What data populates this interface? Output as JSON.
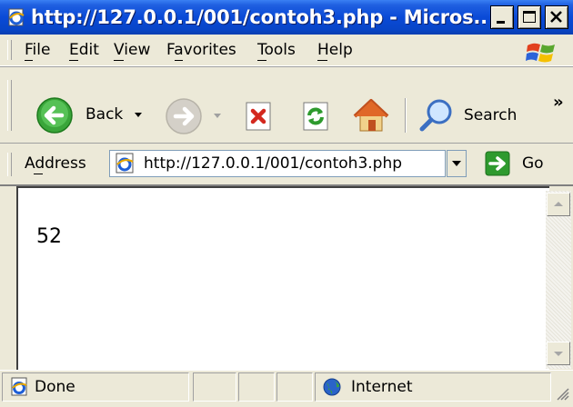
{
  "window": {
    "title": "http://127.0.0.1/001/contoh3.php - Micros...",
    "accent": "#0a4ad7"
  },
  "menu": {
    "items": [
      {
        "label": "File",
        "key": "F"
      },
      {
        "label": "Edit",
        "key": "E"
      },
      {
        "label": "View",
        "key": "V"
      },
      {
        "label": "Favorites",
        "key": "a"
      },
      {
        "label": "Tools",
        "key": "T"
      },
      {
        "label": "Help",
        "key": "H"
      }
    ]
  },
  "toolbar": {
    "back_label": "Back",
    "search_label": "Search",
    "chevron": "»",
    "icons": [
      "back-arrow-icon",
      "forward-arrow-icon",
      "stop-icon",
      "refresh-icon",
      "home-icon",
      "search-icon"
    ]
  },
  "address": {
    "label": "Address",
    "url": "http://127.0.0.1/001/contoh3.php",
    "go_label": "Go"
  },
  "content": {
    "text": "52"
  },
  "status": {
    "left_text": "Done",
    "zone_text": "Internet"
  }
}
